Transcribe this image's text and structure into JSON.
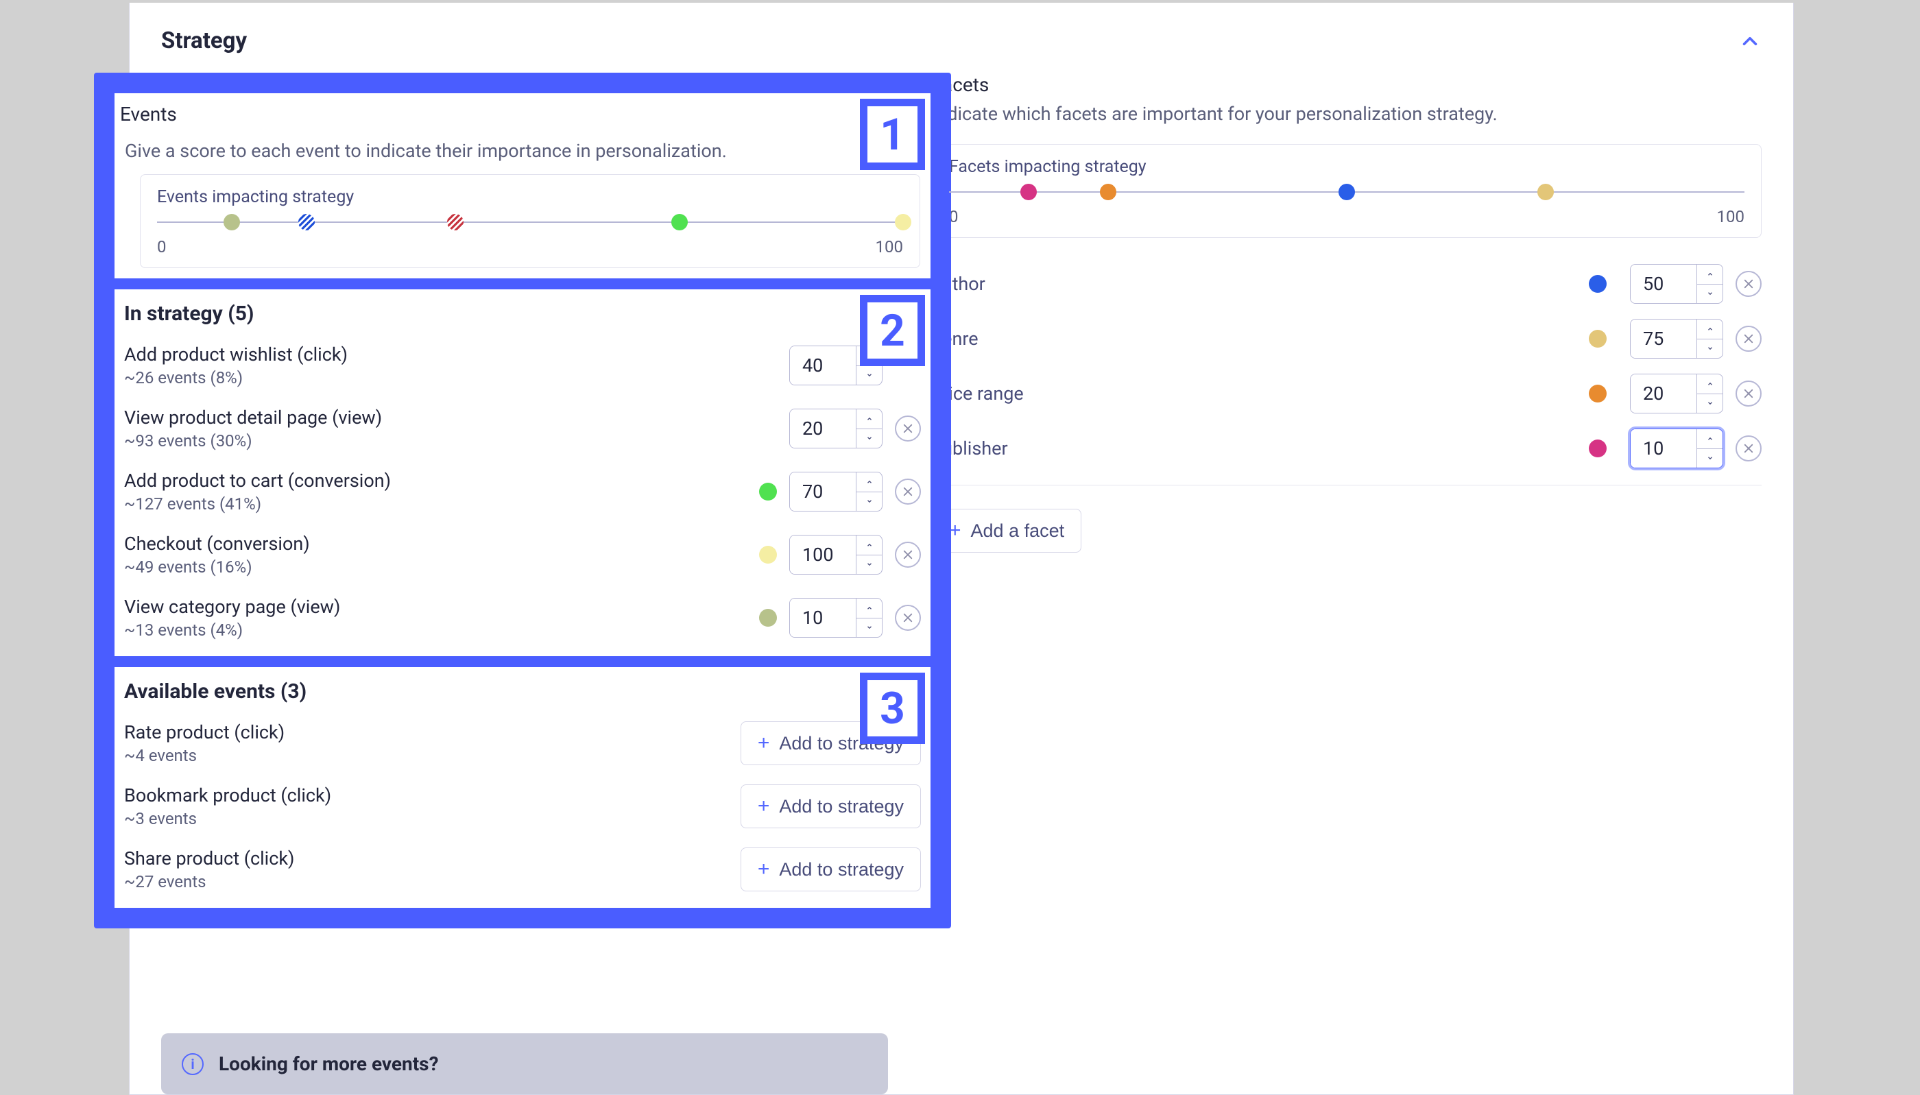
{
  "header": {
    "title": "Strategy"
  },
  "events": {
    "label": "Events",
    "help": "Give a score to each event to indicate their importance in personalization.",
    "impact_label": "Events impacting strategy",
    "scale_min": "0",
    "scale_max": "100",
    "in_strategy_title": "In strategy (5)",
    "items": [
      {
        "name": "Add product wishlist (click)",
        "sub": "~26 events (8%)",
        "value": "40",
        "dot": "stripes-red"
      },
      {
        "name": "View product detail page (view)",
        "sub": "~93 events (30%)",
        "value": "20",
        "dot": "stripes-blue"
      },
      {
        "name": "Add product to cart (conversion)",
        "sub": "~127 events (41%)",
        "value": "70",
        "dot": "#50e150"
      },
      {
        "name": "Checkout (conversion)",
        "sub": "~49 events (16%)",
        "value": "100",
        "dot": "#f5eea3"
      },
      {
        "name": "View category page (view)",
        "sub": "~13 events (4%)",
        "value": "10",
        "dot": "#b7c28b"
      }
    ],
    "impact_dots": [
      {
        "pos": 10,
        "dot": "#b7c28b"
      },
      {
        "pos": 20,
        "dot": "stripes-blue"
      },
      {
        "pos": 40,
        "dot": "stripes-red"
      },
      {
        "pos": 70,
        "dot": "#50e150"
      },
      {
        "pos": 100,
        "dot": "#f5eea3"
      }
    ],
    "available_title": "Available events (3)",
    "available": [
      {
        "name": "Rate product (click)",
        "sub": "~4 events"
      },
      {
        "name": "Bookmark product (click)",
        "sub": "~3 events"
      },
      {
        "name": "Share product (click)",
        "sub": "~27 events"
      }
    ],
    "add_to_strategy_label": "Add to strategy"
  },
  "facets": {
    "label": "Facets",
    "help": "Indicate which facets are important for your personalization strategy.",
    "impact_label": "Facets impacting strategy",
    "scale_min": "0",
    "scale_max": "100",
    "items": [
      {
        "name": "author",
        "value": "50",
        "color": "#2a5ee8"
      },
      {
        "name": "genre",
        "value": "75",
        "color": "#e3c678"
      },
      {
        "name": "price range",
        "value": "20",
        "color": "#e88b2f"
      },
      {
        "name": "publisher",
        "value": "10",
        "color": "#d63384",
        "focused": true
      }
    ],
    "impact_dots": [
      {
        "pos": 10,
        "color": "#d63384"
      },
      {
        "pos": 20,
        "color": "#e88b2f"
      },
      {
        "pos": 50,
        "color": "#2a5ee8"
      },
      {
        "pos": 75,
        "color": "#e3c678"
      }
    ],
    "add_label": "Add a facet"
  },
  "banner": {
    "text": "Looking for more events?"
  },
  "anno_numbers": [
    "1",
    "2",
    "3"
  ]
}
